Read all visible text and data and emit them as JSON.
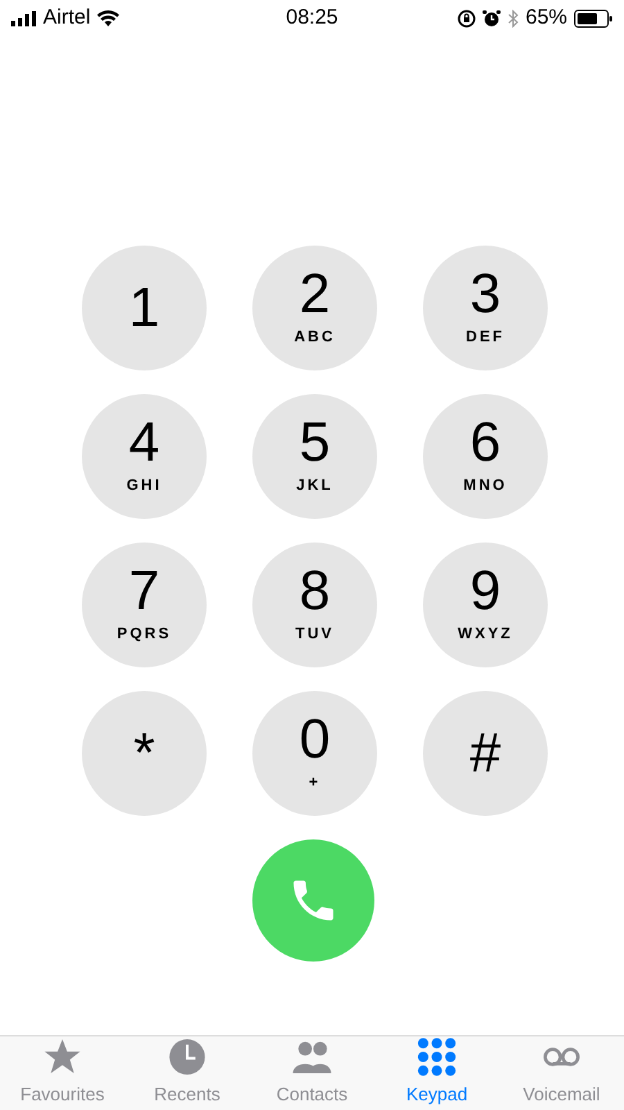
{
  "status_bar": {
    "carrier": "Airtel",
    "time": "08:25",
    "battery": "65%"
  },
  "keys": [
    {
      "digit": "1"
    },
    {
      "digit": "2",
      "letters": "ABC"
    },
    {
      "digit": "3",
      "letters": "DEF"
    },
    {
      "digit": "4",
      "letters": "GHI"
    },
    {
      "digit": "5",
      "letters": "JKL"
    },
    {
      "digit": "6",
      "letters": "MNO"
    },
    {
      "digit": "7",
      "letters": "PQRS"
    },
    {
      "digit": "8",
      "letters": "TUV"
    },
    {
      "digit": "9",
      "letters": "WXYZ"
    },
    {
      "digit": "*"
    },
    {
      "digit": "0",
      "letters": "+"
    },
    {
      "digit": "#"
    }
  ],
  "tabs": [
    {
      "label": "Favourites",
      "kind": "star",
      "selected": false
    },
    {
      "label": "Recents",
      "kind": "clock",
      "selected": false
    },
    {
      "label": "Contacts",
      "kind": "people",
      "selected": false
    },
    {
      "label": "Keypad",
      "kind": "keypad",
      "selected": true
    },
    {
      "label": "Voicemail",
      "kind": "voicemail",
      "selected": false
    }
  ]
}
